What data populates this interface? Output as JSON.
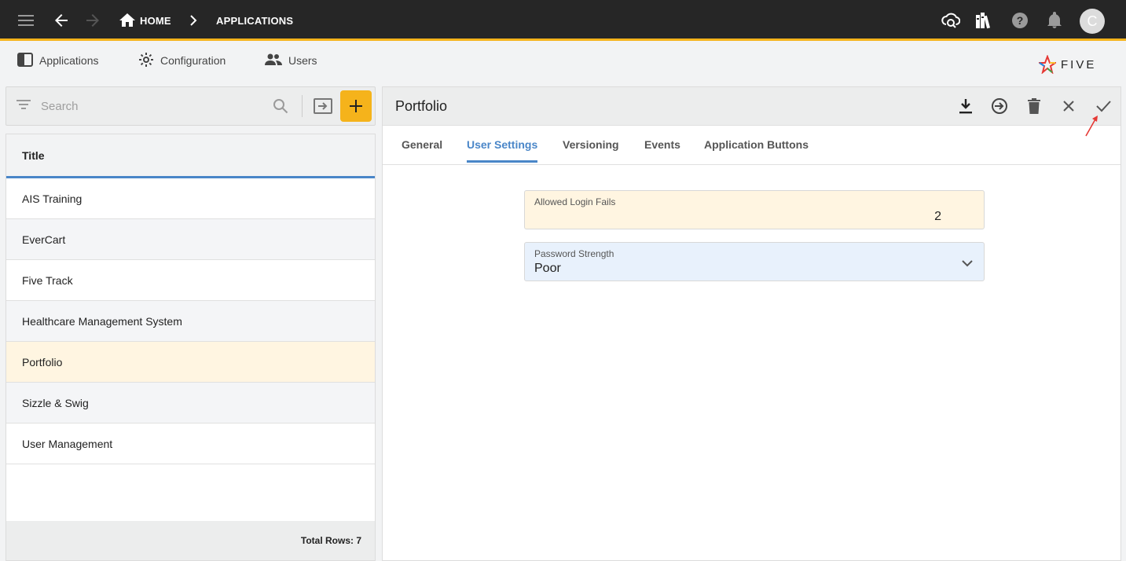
{
  "topbar": {
    "breadcrumbs": {
      "home": "HOME",
      "applications": "APPLICATIONS"
    },
    "avatar_initial": "C",
    "accent_color": "#f5b31b"
  },
  "subnav": {
    "items": [
      {
        "label": "Applications",
        "icon": "application-icon"
      },
      {
        "label": "Configuration",
        "icon": "configuration-icon"
      },
      {
        "label": "Users",
        "icon": "users-icon"
      }
    ],
    "logo_text": "FIVE"
  },
  "search": {
    "placeholder": "Search"
  },
  "list": {
    "header": "Title",
    "rows": [
      "AIS Training",
      "EverCart",
      "Five Track",
      "Healthcare Management System",
      "Portfolio",
      "Sizzle & Swig",
      "User Management"
    ],
    "selected_index": 4,
    "footer": "Total Rows: 7"
  },
  "detail": {
    "title": "Portfolio",
    "tabs": [
      "General",
      "User Settings",
      "Versioning",
      "Events",
      "Application Buttons"
    ],
    "active_tab": 1,
    "fields": {
      "allowed_login_fails": {
        "label": "Allowed Login Fails",
        "value": "2"
      },
      "password_strength": {
        "label": "Password Strength",
        "value": "Poor"
      }
    }
  },
  "colors": {
    "tab_active": "#4a86c8",
    "selected_row": "#fff5e1",
    "field_number_bg": "#fff5e1",
    "field_select_bg": "#e8f1fc"
  }
}
